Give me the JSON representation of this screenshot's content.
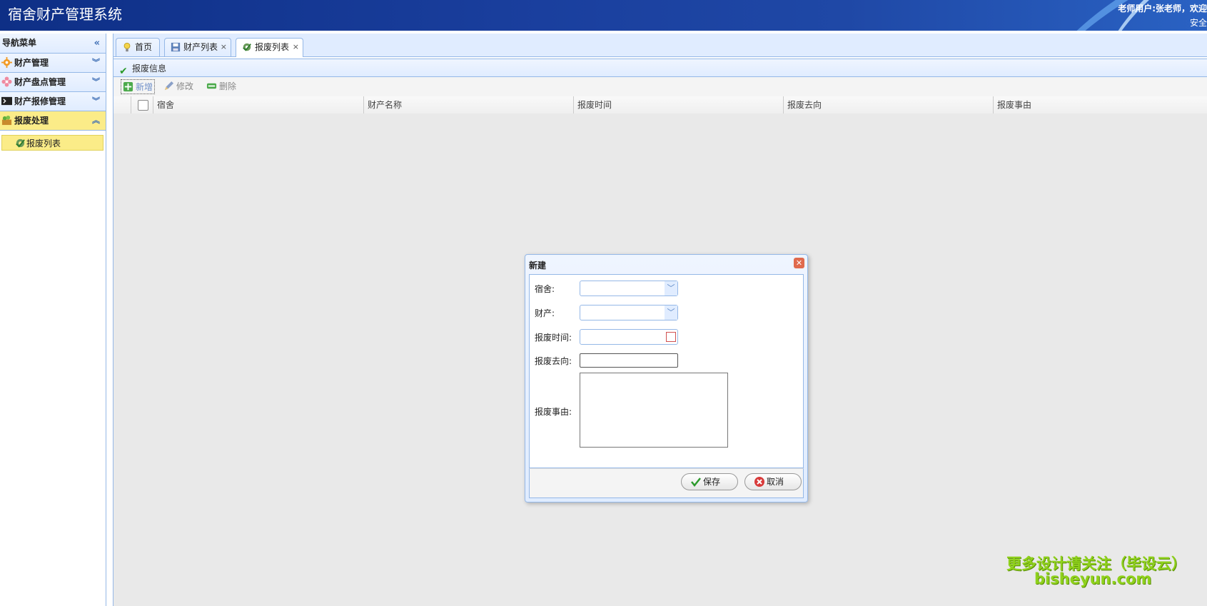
{
  "app": {
    "title": "宿舍财产管理系统",
    "user_greeting": "老师用户:张老师，欢迎",
    "user_sub": "安全"
  },
  "sidebar": {
    "header": "导航菜单",
    "groups": [
      {
        "label": "财产管理",
        "icon": "gear-icon"
      },
      {
        "label": "财产盘点管理",
        "icon": "flower-icon"
      },
      {
        "label": "财产报修管理",
        "icon": "terminal-icon"
      },
      {
        "label": "报废处理",
        "icon": "basket-icon"
      }
    ],
    "sub_items": [
      {
        "label": "报废列表",
        "icon": "gear-check-icon"
      }
    ]
  },
  "tabs": [
    {
      "label": "首页",
      "icon": "lightbulb-icon"
    },
    {
      "label": "财产列表",
      "icon": "save-icon",
      "close": "×"
    },
    {
      "label": "报废列表",
      "icon": "gear-check-icon",
      "close": "×"
    }
  ],
  "panel": {
    "title": "报废信息"
  },
  "toolbar": {
    "add": "新增",
    "edit": "修改",
    "delete": "删除"
  },
  "grid": {
    "columns": [
      "宿舍",
      "财产名称",
      "报废时间",
      "报废去向",
      "报废事由"
    ]
  },
  "dialog": {
    "title": "新建",
    "fields": {
      "dorm": "宿舍:",
      "asset": "财产:",
      "time": "报废时间:",
      "destination": "报废去向:",
      "reason": "报废事由:"
    },
    "save": "保存",
    "cancel": "取消"
  },
  "watermark": {
    "line1": "更多设计请关注（毕设云）",
    "line2": "bisheyun.com"
  }
}
